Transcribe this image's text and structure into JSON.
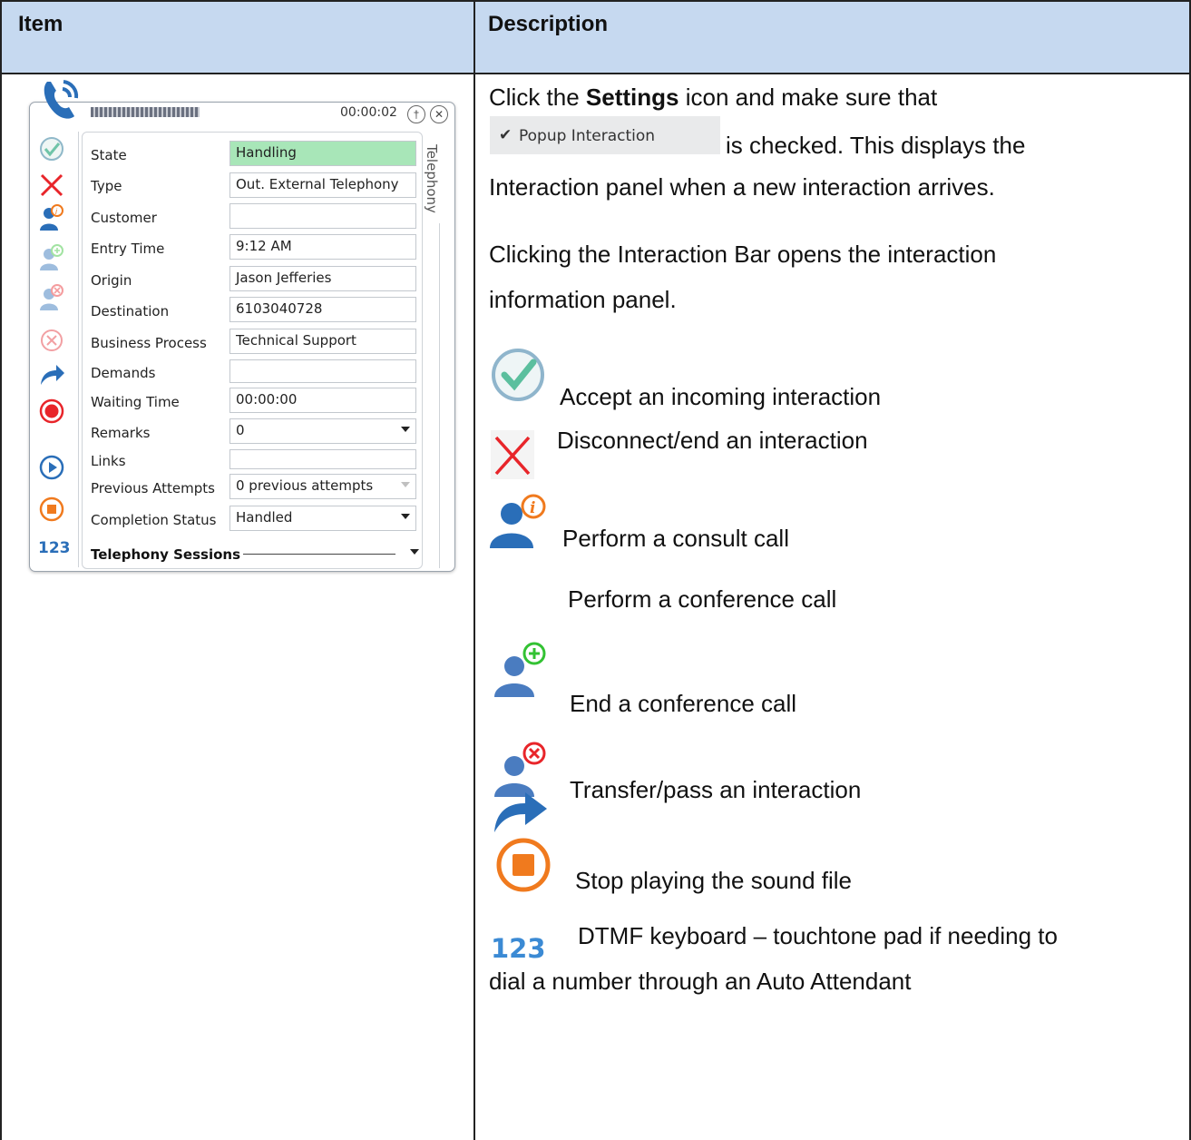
{
  "table": {
    "header_item": "Item",
    "header_description": "Description"
  },
  "panel": {
    "timer": "00:00:02",
    "side_tab": "Telephony",
    "fields": [
      {
        "label": "State",
        "value": "Handling"
      },
      {
        "label": "Type",
        "value": "Out. External Telephony"
      },
      {
        "label": "Customer",
        "value": ""
      },
      {
        "label": "Entry Time",
        "value": "9:12 AM"
      },
      {
        "label": "Origin",
        "value": "Jason Jefferies"
      },
      {
        "label": "Destination",
        "value": "6103040728"
      },
      {
        "label": "Business Process",
        "value": "Technical Support"
      },
      {
        "label": "Demands",
        "value": ""
      },
      {
        "label": "Waiting Time",
        "value": "00:00:00"
      },
      {
        "label": "Remarks",
        "value": "0"
      },
      {
        "label": "Links",
        "value": ""
      },
      {
        "label": "Previous Attempts",
        "value": "0 previous attempts"
      },
      {
        "label": "Completion Status",
        "value": "Handled"
      }
    ],
    "sessions_label": "Telephony Sessions",
    "keypad_label": "123"
  },
  "description": {
    "p1_a": "Click the ",
    "p1_bold": "Settings",
    "p1_b": " icon and make sure that",
    "popup_chip_label": "Popup Interaction",
    "p1_c": "is checked. This displays the",
    "p1_d": "Interaction panel when a new interaction arrives.",
    "p2_a": "Clicking the Interaction Bar opens the interaction",
    "p2_b": "information panel.",
    "accept": "Accept an incoming interaction",
    "disconnect": "Disconnect/end an interaction",
    "consult": "Perform a consult call",
    "conference": "Perform a conference call",
    "end_conference": "End a conference call",
    "transfer": "Transfer/pass an interaction",
    "stop": "Stop playing the sound file",
    "dtmf_a": "DTMF keyboard – touchtone pad if needing to",
    "dtmf_b": "dial a number through an Auto Attendant",
    "keypad_label": "123"
  },
  "colors": {
    "header_bg": "#c6d9f0",
    "state_green": "#a8e6b8",
    "accent_blue": "#2a6eb8",
    "stop_orange": "#f07a1e",
    "record_red": "#e8252a"
  }
}
